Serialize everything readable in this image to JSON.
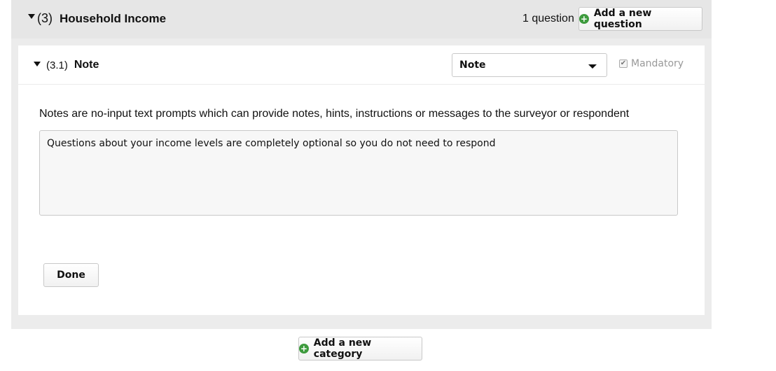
{
  "category": {
    "number": "(3)",
    "title": "Household Income",
    "question_count": "1 question",
    "add_question_label": "Add a new question"
  },
  "question": {
    "number": "(3.1)",
    "title": "Note",
    "type_select": {
      "selected": "Note"
    },
    "mandatory": {
      "label": "Mandatory",
      "checked": true,
      "disabled": true
    },
    "description": "Notes are no-input text prompts which can provide notes, hints, instructions or messages to the surveyor or respondent",
    "note_value": "Questions about your income levels are completely optional so you do not need to respond",
    "done_label": "Done"
  },
  "footer": {
    "add_category_label": "Add a new category"
  },
  "icons": {
    "expand": "caret-down-icon",
    "add": "plus-circle-icon",
    "select": "chevron-down-icon",
    "check": "checkbox-icon"
  },
  "colors": {
    "category_bg": "#ececec",
    "accent_green": "#3e9b3e",
    "muted_text": "#999999"
  }
}
